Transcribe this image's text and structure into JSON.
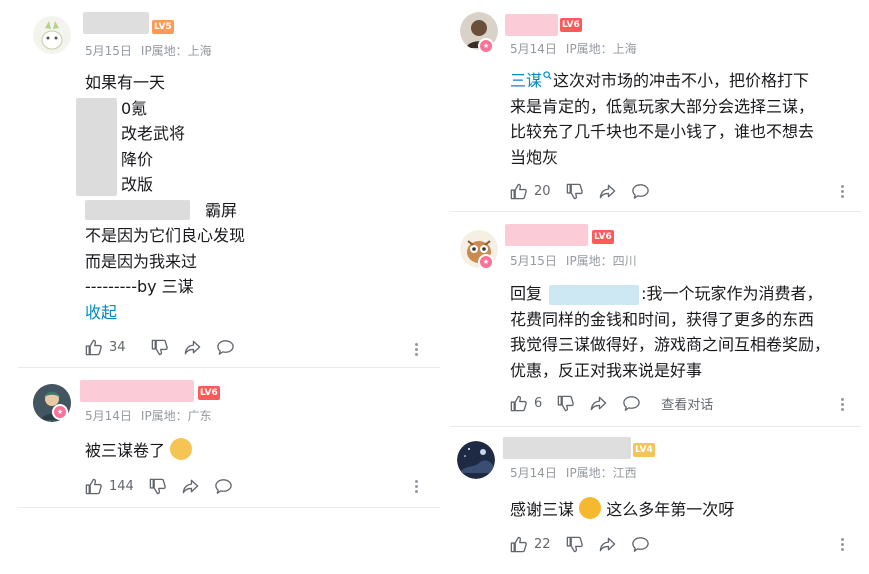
{
  "left": {
    "comments": [
      {
        "level": "LV5",
        "date": "5月15日",
        "ip": "IP属地：上海",
        "lines": {
          "l1": "如果有一天",
          "l2": "0氪",
          "l3": "改老武将",
          "l4": "降价",
          "l5": "改版",
          "l6": "霸屏",
          "l7": "不是因为它们良心发现",
          "l8": "而是因为我来过",
          "l9": "---------by 三谋"
        },
        "collapse": "收起",
        "likes": "34"
      },
      {
        "level": "LV6",
        "date": "5月14日",
        "ip": "IP属地：广东",
        "text": "被三谋卷了",
        "likes": "144"
      }
    ]
  },
  "right": {
    "comments": [
      {
        "level": "LV6",
        "date": "5月14日",
        "ip": "IP属地：上海",
        "link": "三谋",
        "lines": {
          "l1": "这次对市场的冲击不小，把价格打下",
          "l2": "来是肯定的，低氪玩家大部分会选择三谋，",
          "l3": "比较充了几千块也不是小钱了，谁也不想去",
          "l4": "当炮灰"
        },
        "likes": "20"
      },
      {
        "level": "LV6",
        "date": "5月15日",
        "ip": "IP属地：四川",
        "reply_prefix": "回复",
        "lines": {
          "l1": ":我一个玩家作为消费者，",
          "l2": "花费同样的金钱和时间，获得了更多的东西",
          "l3": "我觉得三谋做得好，游戏商之间互相卷奖励，",
          "l4": "优惠，反正对我来说是好事"
        },
        "likes": "6",
        "view_conversation": "查看对话"
      },
      {
        "level": "LV4",
        "date": "5月14日",
        "ip": "IP属地：江西",
        "text_a": "感谢三谋",
        "text_b": "这么多年第一次呀",
        "likes": "22"
      }
    ]
  },
  "colors": {
    "lv4": "#f2c45a",
    "lv5": "#ff9a56",
    "lv6": "#ff5a5a",
    "link": "#008ac5",
    "name_pink": "#fbcbd8",
    "name_gray": "#dedede",
    "name_blue": "#cde8f2"
  }
}
